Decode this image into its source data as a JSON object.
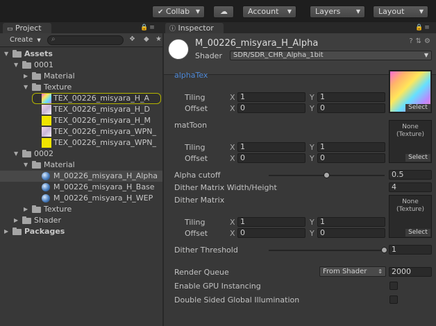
{
  "toolbar": {
    "collab": "Collab",
    "account": "Account",
    "layers": "Layers",
    "layout": "Layout"
  },
  "project": {
    "tab": "Project",
    "create": "Create",
    "tree": [
      {
        "label": "Assets",
        "indent": 0,
        "kind": "folder",
        "arrow": "open",
        "bold": true
      },
      {
        "label": "0001",
        "indent": 1,
        "kind": "folder",
        "arrow": "open"
      },
      {
        "label": "Material",
        "indent": 2,
        "kind": "folder",
        "arrow": "closed"
      },
      {
        "label": "Texture",
        "indent": 2,
        "kind": "folder",
        "arrow": "open"
      },
      {
        "label": "TEX_00226_misyara_H_A",
        "indent": 3,
        "kind": "thumb-rainbow",
        "highlight": true
      },
      {
        "label": "TEX_00226_misyara_H_D",
        "indent": 3,
        "kind": "thumb-pink"
      },
      {
        "label": "TEX_00226_misyara_H_M",
        "indent": 3,
        "kind": "thumb-yellow"
      },
      {
        "label": "TEX_00226_misyara_WPN_",
        "indent": 3,
        "kind": "thumb-pink"
      },
      {
        "label": "TEX_00226_misyara_WPN_",
        "indent": 3,
        "kind": "thumb-yellow"
      },
      {
        "label": "0002",
        "indent": 1,
        "kind": "folder",
        "arrow": "open"
      },
      {
        "label": "Material",
        "indent": 2,
        "kind": "folder",
        "arrow": "open"
      },
      {
        "label": "M_00226_misyara_H_Alpha",
        "indent": 3,
        "kind": "material",
        "selected": true
      },
      {
        "label": "M_00226_misyara_H_Base",
        "indent": 3,
        "kind": "material"
      },
      {
        "label": "M_00226_misyara_H_WEP",
        "indent": 3,
        "kind": "material"
      },
      {
        "label": "Texture",
        "indent": 2,
        "kind": "folder",
        "arrow": "closed"
      },
      {
        "label": "Shader",
        "indent": 1,
        "kind": "folder",
        "arrow": "closed"
      },
      {
        "label": "Packages",
        "indent": 0,
        "kind": "folder",
        "arrow": "closed",
        "bold": true
      }
    ]
  },
  "inspector": {
    "tab": "Inspector",
    "material_name": "M_00226_misyara_H_Alpha",
    "shader_label": "Shader",
    "shader_value": "SDR/SDR_CHR_Alpha_1bit",
    "props": {
      "alphaTex": "alphaTex",
      "tiling": "Tiling",
      "offset": "Offset",
      "x": "X",
      "y": "Y",
      "tiling_x": "1",
      "tiling_y": "1",
      "offset_x": "0",
      "offset_y": "0",
      "select": "Select",
      "matToon": "matToon",
      "none_texture": "None\n(Texture)",
      "alpha_cutoff": "Alpha cutoff",
      "alpha_cutoff_value": "0.5",
      "alpha_cutoff_fraction": 0.5,
      "dither_wh": "Dither Matrix Width/Height",
      "dither_wh_value": "4",
      "dither_matrix": "Dither Matrix",
      "dither_threshold": "Dither Threshold",
      "dither_threshold_value": "1",
      "dither_threshold_fraction": 1.0,
      "render_queue": "Render Queue",
      "render_queue_mode": "From Shader",
      "render_queue_value": "2000",
      "gpu_instancing": "Enable GPU Instancing",
      "double_sided_gi": "Double Sided Global Illumination"
    }
  },
  "colors": {
    "accent_label": "#4f8ad8",
    "highlight_outline": "#b4b400"
  }
}
